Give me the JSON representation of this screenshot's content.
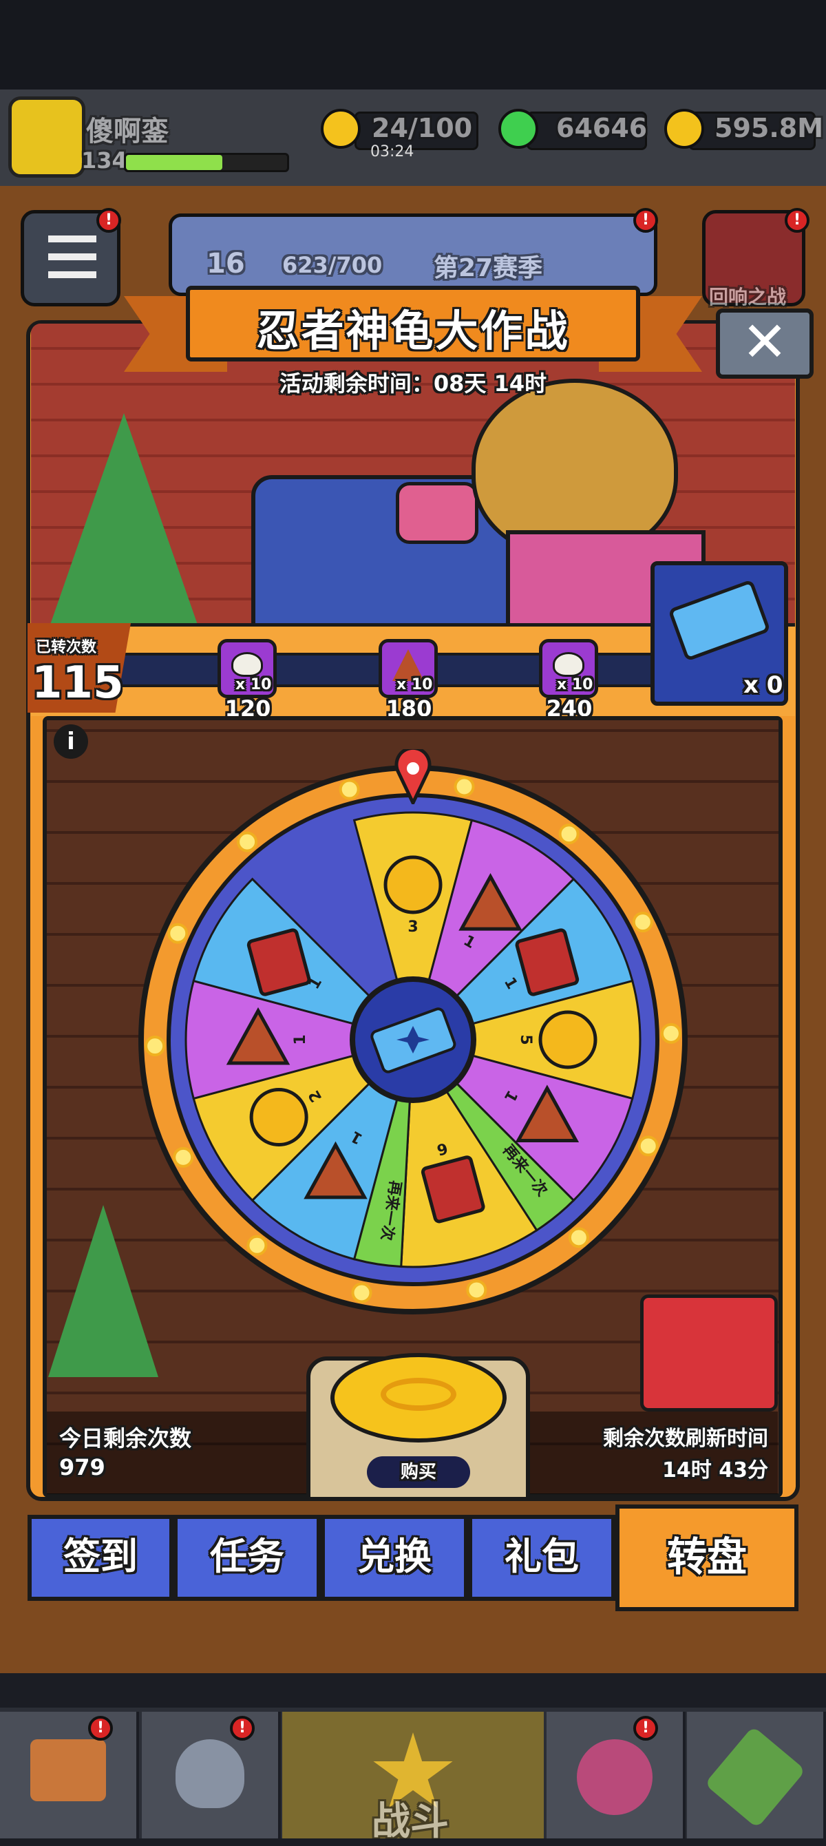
{
  "player": {
    "name": "傻啊銮",
    "level": "134"
  },
  "resources": {
    "energy": "24/100",
    "energy_timer": "03:24",
    "gems": "64646",
    "coins": "595.8M"
  },
  "season": {
    "level": "16",
    "xp": "623/700",
    "label": "第27赛季"
  },
  "side_button": {
    "label": "回响之战"
  },
  "event": {
    "title": "忍者神龟大作战",
    "countdown": "活动剩余时间：08天 14时",
    "spun_label": "已转次数",
    "spun_count": "115",
    "ticket_count": "x 0",
    "milestones": [
      {
        "count": "x 10",
        "value": "120",
        "icon": "teapot-icon"
      },
      {
        "count": "x 10",
        "value": "180",
        "icon": "pizza-icon"
      },
      {
        "count": "x 10",
        "value": "240",
        "icon": "teapot-icon"
      }
    ],
    "wheel": {
      "segments": [
        {
          "icon": "coin-icon",
          "qty": "3"
        },
        {
          "icon": "pizza-icon",
          "qty": "1"
        },
        {
          "icon": "book-icon",
          "qty": "1"
        },
        {
          "icon": "coin-icon",
          "qty": "5"
        },
        {
          "icon": "pizza-icon",
          "qty": "1"
        },
        {
          "icon": "retry-label",
          "qty": "再来一次"
        },
        {
          "icon": "book-icon",
          "qty": "6"
        },
        {
          "icon": "retry-label",
          "qty": "再来一次"
        },
        {
          "icon": "pizza-icon",
          "qty": "1"
        },
        {
          "icon": "coin-icon",
          "qty": "2"
        },
        {
          "icon": "pizza-icon",
          "qty": "1"
        },
        {
          "icon": "book-icon",
          "qty": "1"
        }
      ]
    },
    "remaining_label": "今日剩余次数",
    "remaining_value": "979",
    "refresh_label": "剩余次数刷新时间",
    "refresh_value": "14时 43分",
    "buy_label": "购买"
  },
  "tabs": [
    "签到",
    "任务",
    "兑换",
    "礼包",
    "转盘"
  ],
  "active_tab": "转盘",
  "bottom_nav": {
    "fight_label": "战斗"
  },
  "colors": {
    "orange": "#f39a2e",
    "tab_blue": "#4a63d8",
    "wheel_yellow": "#f4cb2f",
    "wheel_purple": "#c964e6",
    "wheel_blue": "#59b8f0",
    "wheel_green": "#7bd24c"
  }
}
